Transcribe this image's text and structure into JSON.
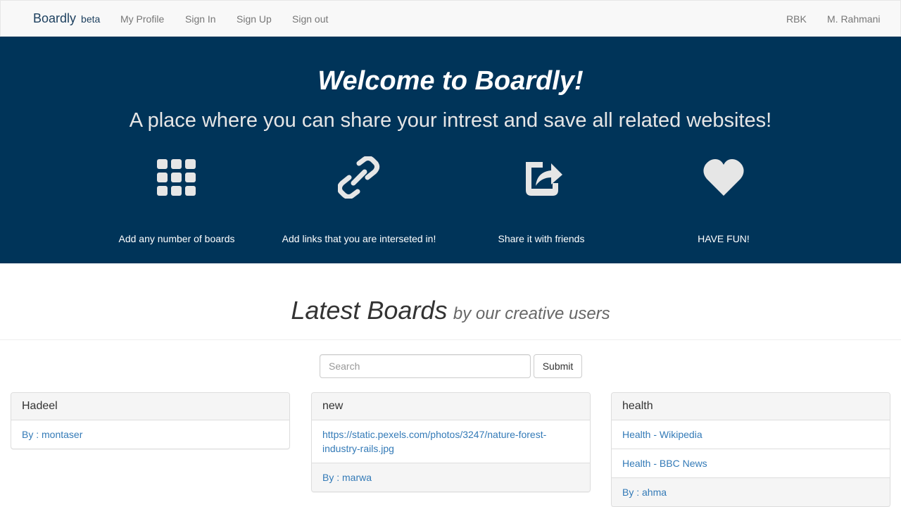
{
  "navbar": {
    "brand": "Boardly",
    "brand_badge": "beta",
    "links": [
      "My Profile",
      "Sign In",
      "Sign Up",
      "Sign out"
    ],
    "right_links": [
      "RBK",
      "M. Rahmani"
    ]
  },
  "hero": {
    "title": "Welcome to Boardly!",
    "subtitle": "A place where you can share your intrest and save all related websites!",
    "features": [
      {
        "icon": "grid-icon",
        "label": "Add any number of boards"
      },
      {
        "icon": "link-icon",
        "label": "Add links that you are interseted in!"
      },
      {
        "icon": "share-icon",
        "label": "Share it with friends"
      },
      {
        "icon": "heart-icon",
        "label": "HAVE FUN!"
      }
    ],
    "background": "#003459"
  },
  "latest": {
    "title": "Latest Boards",
    "subtitle": "by our creative users"
  },
  "search": {
    "placeholder": "Search",
    "value": "",
    "submit_label": "Submit"
  },
  "boards": [
    {
      "title": "Hadeel",
      "links": [],
      "author": "By : montaser"
    },
    {
      "title": "new",
      "links": [
        "https://static.pexels.com/photos/3247/nature-forest-industry-rails.jpg"
      ],
      "author": "By : marwa"
    },
    {
      "title": "health",
      "links": [
        "Health - Wikipedia",
        "Health - BBC News"
      ],
      "author": "By : ahma"
    }
  ]
}
